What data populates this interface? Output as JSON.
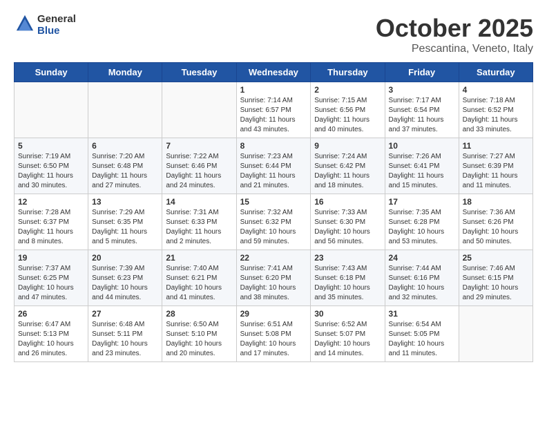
{
  "header": {
    "logo_general": "General",
    "logo_blue": "Blue",
    "month_title": "October 2025",
    "subtitle": "Pescantina, Veneto, Italy"
  },
  "weekdays": [
    "Sunday",
    "Monday",
    "Tuesday",
    "Wednesday",
    "Thursday",
    "Friday",
    "Saturday"
  ],
  "weeks": [
    [
      {
        "day": "",
        "info": ""
      },
      {
        "day": "",
        "info": ""
      },
      {
        "day": "",
        "info": ""
      },
      {
        "day": "1",
        "info": "Sunrise: 7:14 AM\nSunset: 6:57 PM\nDaylight: 11 hours and 43 minutes."
      },
      {
        "day": "2",
        "info": "Sunrise: 7:15 AM\nSunset: 6:56 PM\nDaylight: 11 hours and 40 minutes."
      },
      {
        "day": "3",
        "info": "Sunrise: 7:17 AM\nSunset: 6:54 PM\nDaylight: 11 hours and 37 minutes."
      },
      {
        "day": "4",
        "info": "Sunrise: 7:18 AM\nSunset: 6:52 PM\nDaylight: 11 hours and 33 minutes."
      }
    ],
    [
      {
        "day": "5",
        "info": "Sunrise: 7:19 AM\nSunset: 6:50 PM\nDaylight: 11 hours and 30 minutes."
      },
      {
        "day": "6",
        "info": "Sunrise: 7:20 AM\nSunset: 6:48 PM\nDaylight: 11 hours and 27 minutes."
      },
      {
        "day": "7",
        "info": "Sunrise: 7:22 AM\nSunset: 6:46 PM\nDaylight: 11 hours and 24 minutes."
      },
      {
        "day": "8",
        "info": "Sunrise: 7:23 AM\nSunset: 6:44 PM\nDaylight: 11 hours and 21 minutes."
      },
      {
        "day": "9",
        "info": "Sunrise: 7:24 AM\nSunset: 6:42 PM\nDaylight: 11 hours and 18 minutes."
      },
      {
        "day": "10",
        "info": "Sunrise: 7:26 AM\nSunset: 6:41 PM\nDaylight: 11 hours and 15 minutes."
      },
      {
        "day": "11",
        "info": "Sunrise: 7:27 AM\nSunset: 6:39 PM\nDaylight: 11 hours and 11 minutes."
      }
    ],
    [
      {
        "day": "12",
        "info": "Sunrise: 7:28 AM\nSunset: 6:37 PM\nDaylight: 11 hours and 8 minutes."
      },
      {
        "day": "13",
        "info": "Sunrise: 7:29 AM\nSunset: 6:35 PM\nDaylight: 11 hours and 5 minutes."
      },
      {
        "day": "14",
        "info": "Sunrise: 7:31 AM\nSunset: 6:33 PM\nDaylight: 11 hours and 2 minutes."
      },
      {
        "day": "15",
        "info": "Sunrise: 7:32 AM\nSunset: 6:32 PM\nDaylight: 10 hours and 59 minutes."
      },
      {
        "day": "16",
        "info": "Sunrise: 7:33 AM\nSunset: 6:30 PM\nDaylight: 10 hours and 56 minutes."
      },
      {
        "day": "17",
        "info": "Sunrise: 7:35 AM\nSunset: 6:28 PM\nDaylight: 10 hours and 53 minutes."
      },
      {
        "day": "18",
        "info": "Sunrise: 7:36 AM\nSunset: 6:26 PM\nDaylight: 10 hours and 50 minutes."
      }
    ],
    [
      {
        "day": "19",
        "info": "Sunrise: 7:37 AM\nSunset: 6:25 PM\nDaylight: 10 hours and 47 minutes."
      },
      {
        "day": "20",
        "info": "Sunrise: 7:39 AM\nSunset: 6:23 PM\nDaylight: 10 hours and 44 minutes."
      },
      {
        "day": "21",
        "info": "Sunrise: 7:40 AM\nSunset: 6:21 PM\nDaylight: 10 hours and 41 minutes."
      },
      {
        "day": "22",
        "info": "Sunrise: 7:41 AM\nSunset: 6:20 PM\nDaylight: 10 hours and 38 minutes."
      },
      {
        "day": "23",
        "info": "Sunrise: 7:43 AM\nSunset: 6:18 PM\nDaylight: 10 hours and 35 minutes."
      },
      {
        "day": "24",
        "info": "Sunrise: 7:44 AM\nSunset: 6:16 PM\nDaylight: 10 hours and 32 minutes."
      },
      {
        "day": "25",
        "info": "Sunrise: 7:46 AM\nSunset: 6:15 PM\nDaylight: 10 hours and 29 minutes."
      }
    ],
    [
      {
        "day": "26",
        "info": "Sunrise: 6:47 AM\nSunset: 5:13 PM\nDaylight: 10 hours and 26 minutes."
      },
      {
        "day": "27",
        "info": "Sunrise: 6:48 AM\nSunset: 5:11 PM\nDaylight: 10 hours and 23 minutes."
      },
      {
        "day": "28",
        "info": "Sunrise: 6:50 AM\nSunset: 5:10 PM\nDaylight: 10 hours and 20 minutes."
      },
      {
        "day": "29",
        "info": "Sunrise: 6:51 AM\nSunset: 5:08 PM\nDaylight: 10 hours and 17 minutes."
      },
      {
        "day": "30",
        "info": "Sunrise: 6:52 AM\nSunset: 5:07 PM\nDaylight: 10 hours and 14 minutes."
      },
      {
        "day": "31",
        "info": "Sunrise: 6:54 AM\nSunset: 5:05 PM\nDaylight: 10 hours and 11 minutes."
      },
      {
        "day": "",
        "info": ""
      }
    ]
  ]
}
